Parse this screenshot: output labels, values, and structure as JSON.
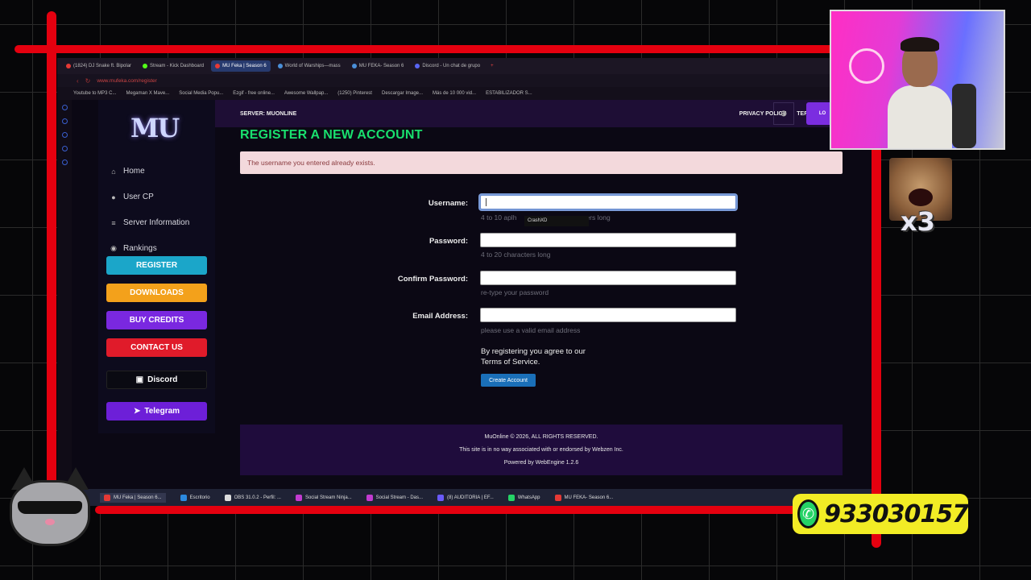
{
  "browser": {
    "tabs": [
      {
        "label": "(1824) DJ Snake ft. Bipolar",
        "color": "#e53935",
        "active": false
      },
      {
        "label": "Stream - Kick Dashboard",
        "color": "#53fc18",
        "active": false
      },
      {
        "label": "MU Feka | Season 6",
        "color": "#e53935",
        "active": true
      },
      {
        "label": "World of Warships—mass",
        "color": "#4a8fd8",
        "active": false
      },
      {
        "label": "MU FEKA- Season 6",
        "color": "#4a8fd8",
        "active": false
      },
      {
        "label": "Discord - Un chat de grupo",
        "color": "#5865f2",
        "active": false
      }
    ],
    "new_tab": "+",
    "url": "www.mufeka.com/register",
    "bookmarks": [
      "Youtube to MP3 C...",
      "Megaman X Mave...",
      "Social Media Popu...",
      "Ezgif - free online...",
      "Awesome Wallpap...",
      "(1250) Pinterest",
      "Descargar Image...",
      "Más de 10 000 vid...",
      "ESTABILIZADOR S..."
    ]
  },
  "sidebar": {
    "logo": "MU",
    "items": [
      {
        "label": "Home",
        "icon": "home-icon",
        "glyph": "⌂"
      },
      {
        "label": "User CP",
        "icon": "user-icon",
        "glyph": "●"
      },
      {
        "label": "Server Information",
        "icon": "list-icon",
        "glyph": "≡"
      },
      {
        "label": "Rankings",
        "icon": "users-icon",
        "glyph": "◉"
      }
    ],
    "buttons": [
      {
        "label": "REGISTER",
        "color": "#1ba6c9"
      },
      {
        "label": "DOWNLOADS",
        "color": "#f3a11b"
      },
      {
        "label": "BUY CREDITS",
        "color": "#7a28e0"
      },
      {
        "label": "CONTACT US",
        "color": "#e01b2a"
      },
      {
        "label": "Discord",
        "color": "#0a0a12",
        "icon": "discord-icon"
      },
      {
        "label": "Telegram",
        "color": "#6d1fd8",
        "icon": "telegram-icon"
      }
    ]
  },
  "topbar": {
    "server": "SERVER: MUONLINE",
    "links": [
      "PRIVACY POLICY",
      "TERMS OF SERVICE"
    ],
    "login": "LO"
  },
  "page": {
    "title": "REGISTER A NEW ACCOUNT",
    "alert": "The username you entered already exists.",
    "form": {
      "username_label": "Username:",
      "username_hint": "4 to 10 aphanumeric characters long",
      "username_hint_visible_a": "4 to 10 aplh",
      "username_hint_visible_b": "ers long",
      "autocomplete": "CrashXD",
      "password_label": "Password:",
      "password_hint": "4 to 20 characters long",
      "confirm_label": "Confirm Password:",
      "confirm_hint": "re-type your password",
      "email_label": "Email Address:",
      "email_hint": "please use a valid email address",
      "agree_line1": "By registering you agree to our",
      "agree_line2": "Terms of Service.",
      "submit": "Create Account"
    }
  },
  "footer": {
    "line1": "MuOnline © 2026, ALL RIGHTS RESERVED.",
    "line2": "This site is in no way associated with or endorsed by Webzen Inc.",
    "line3": "Powered by WebEngine 1.2.6"
  },
  "taskbar": {
    "items": [
      {
        "label": "MU Feka | Season 6...",
        "color": "#e53935",
        "active": true
      },
      {
        "label": "Escritorio",
        "color": "#2b8ae0",
        "active": false
      },
      {
        "label": "OBS 31.0.2 - Perfil: ...",
        "color": "#ddd",
        "active": false
      },
      {
        "label": "Social Stream Ninja...",
        "color": "#c23bd0",
        "active": false
      },
      {
        "label": "Social Stream - Das...",
        "color": "#c23bd0",
        "active": false
      },
      {
        "label": "(8) AUDITORIA | EF...",
        "color": "#6a5af9",
        "active": false
      },
      {
        "label": "WhatsApp",
        "color": "#25d366",
        "active": false
      },
      {
        "label": "MU FEKA- Season 6...",
        "color": "#e53935",
        "active": false
      }
    ]
  },
  "overlay": {
    "emote_multiplier": "x3",
    "phone": "933030157",
    "accent_red": "#e4000f",
    "phone_bg": "#f2ec25"
  }
}
